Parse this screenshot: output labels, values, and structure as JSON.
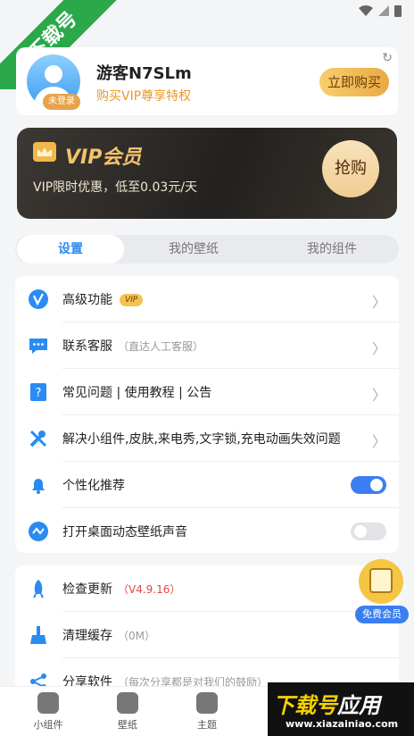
{
  "watermark": {
    "text": "下载号"
  },
  "profile": {
    "name": "游客N7SLm",
    "subtitle": "购买VIP尊享特权",
    "login_tag": "未登录",
    "buy_button": "立即购买"
  },
  "vip_banner": {
    "title": "VIP会员",
    "description": "VIP限时优惠，低至0.03元/天",
    "button": "抢购"
  },
  "tabs": [
    {
      "label": "设置",
      "active": true
    },
    {
      "label": "我的壁纸",
      "active": false
    },
    {
      "label": "我的组件",
      "active": false
    }
  ],
  "settings": [
    {
      "label": "高级功能",
      "badge": "VIP"
    },
    {
      "label": "联系客服",
      "note": "（直达人工客服）"
    },
    {
      "label": "常见问题 | 使用教程 | 公告"
    },
    {
      "label": "解决小组件,皮肤,来电秀,文字锁,充电动画失效问题"
    },
    {
      "label": "个性化推荐",
      "toggle": true
    },
    {
      "label": "打开桌面动态壁纸声音",
      "toggle": false
    }
  ],
  "settings2": [
    {
      "label": "检查更新",
      "version": "（V4.9.16）"
    },
    {
      "label": "清理缓存",
      "note": "（0M）"
    },
    {
      "label": "分享软件",
      "note": "（每次分享都是对我们的鼓励）"
    }
  ],
  "floating": {
    "label": "免费会员"
  },
  "bottom_nav": [
    {
      "label": "小组件"
    },
    {
      "label": "壁纸"
    },
    {
      "label": "主题"
    }
  ],
  "brand": {
    "title_a": "下载号",
    "title_b": "应用",
    "url": "www.xiazainiao.com"
  },
  "colors": {
    "accent": "#2a8bf2",
    "toggle_on": "#3d7ef2",
    "gold": "#f2c36f",
    "vip_bg": "#232120"
  }
}
